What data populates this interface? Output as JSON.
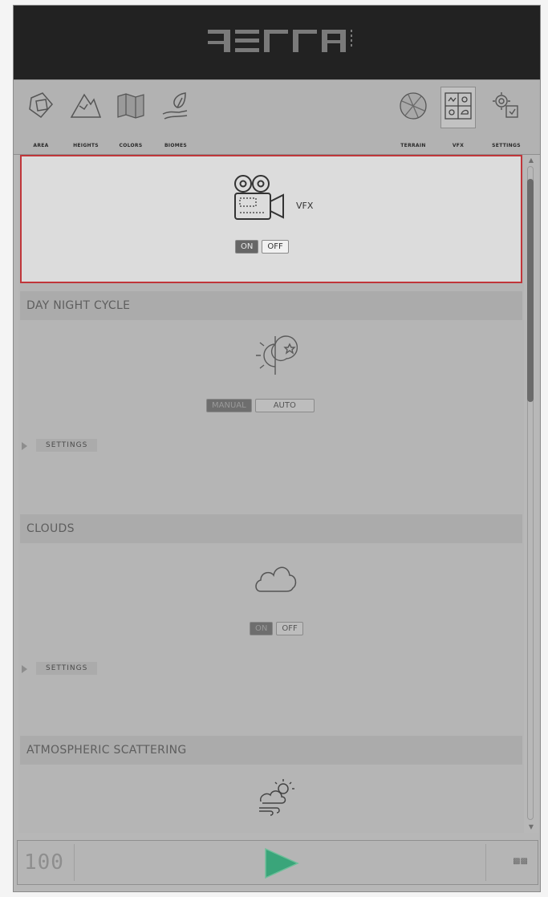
{
  "header": {
    "logo_text": "TERRA"
  },
  "toolbar": {
    "left_tools": [
      {
        "label": "AREA",
        "icon": "area-icon"
      },
      {
        "label": "HEIGHTS",
        "icon": "mountain-icon"
      },
      {
        "label": "COLORS",
        "icon": "map-icon"
      },
      {
        "label": "BIOMES",
        "icon": "leaf-hand-icon"
      }
    ],
    "right_tools": [
      {
        "label": "TERRAIN",
        "icon": "globe-icon"
      },
      {
        "label": "VFX",
        "icon": "vfx-grid-icon",
        "active": true
      },
      {
        "label": "SETTINGS",
        "icon": "gears-icon"
      }
    ]
  },
  "vfx": {
    "label": "VFX",
    "on": "ON",
    "off": "OFF",
    "selected": "ON"
  },
  "day_night": {
    "title": "DAY NIGHT CYCLE",
    "manual": "MANUAL",
    "auto": "AUTO",
    "settings": "SETTINGS"
  },
  "clouds": {
    "title": "CLOUDS",
    "on": "ON",
    "off": "OFF",
    "settings": "SETTINGS"
  },
  "atmo": {
    "title": "ATMOSPHERIC SCATTERING"
  },
  "footer": {
    "counter": "100",
    "mini_label": "▩▩"
  },
  "colors": {
    "header_bg": "#222222",
    "accent_border": "#c0363a",
    "play_green": "#3aa57a"
  }
}
